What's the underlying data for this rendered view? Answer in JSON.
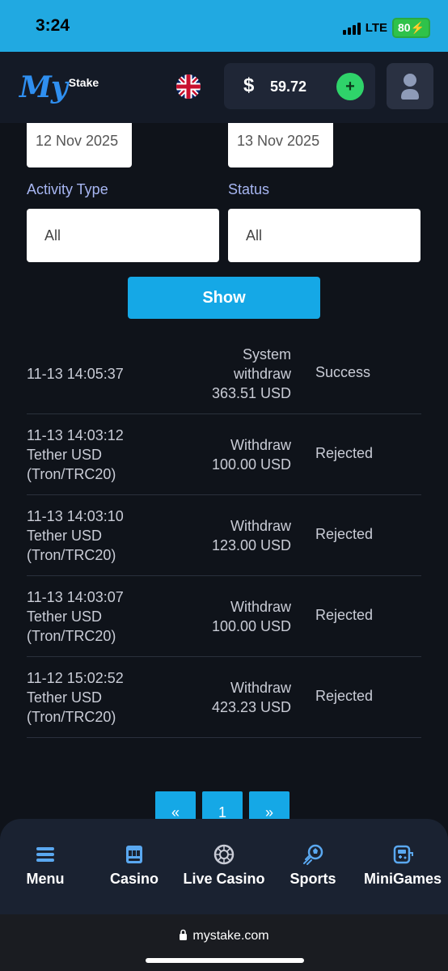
{
  "status_bar": {
    "time": "3:24",
    "network": "LTE",
    "battery": "80"
  },
  "header": {
    "logo_my": "My",
    "logo_stake": "Stake",
    "currency_symbol": "$",
    "balance": "59.72",
    "deposit_label": "+"
  },
  "filters": {
    "date_from": "12 Nov 2025",
    "date_to": "13 Nov 2025",
    "activity_type_label": "Activity Type",
    "activity_type_value": "All",
    "status_label": "Status",
    "status_value": "All",
    "show_button": "Show"
  },
  "transactions": [
    {
      "date": "11-13 14:05:37",
      "method_line1": "",
      "method_line2": "",
      "type_line1": "System",
      "type_line2": "withdraw",
      "amount": "363.51 USD",
      "status": "Success"
    },
    {
      "date": "11-13 14:03:12",
      "method_line1": "Tether USD",
      "method_line2": "(Tron/TRC20)",
      "type_line1": "",
      "type_line2": "Withdraw",
      "amount": "100.00 USD",
      "status": "Rejected"
    },
    {
      "date": "11-13 14:03:10",
      "method_line1": "Tether USD",
      "method_line2": "(Tron/TRC20)",
      "type_line1": "",
      "type_line2": "Withdraw",
      "amount": "123.00 USD",
      "status": "Rejected"
    },
    {
      "date": "11-13 14:03:07",
      "method_line1": "Tether USD",
      "method_line2": "(Tron/TRC20)",
      "type_line1": "",
      "type_line2": "Withdraw",
      "amount": "100.00 USD",
      "status": "Rejected"
    },
    {
      "date": "11-12 15:02:52",
      "method_line1": "Tether USD",
      "method_line2": "(Tron/TRC20)",
      "type_line1": "",
      "type_line2": "Withdraw",
      "amount": "423.23 USD",
      "status": "Rejected"
    }
  ],
  "pagination": {
    "prev": "«",
    "current": "1",
    "next": "»"
  },
  "bottom_nav": [
    {
      "label": "Menu",
      "icon": "hamburger-icon"
    },
    {
      "label": "Casino",
      "icon": "slot-machine-icon"
    },
    {
      "label": "Live Casino",
      "icon": "roulette-icon"
    },
    {
      "label": "Sports",
      "icon": "soccer-ball-icon"
    },
    {
      "label": "MiniGames",
      "icon": "gamepad-icon"
    }
  ],
  "browser": {
    "url": "mystake.com"
  },
  "colors": {
    "accent": "#15a8e6",
    "background": "#0f131a",
    "deposit": "#2fd36a",
    "label": "#a7b6f2"
  }
}
